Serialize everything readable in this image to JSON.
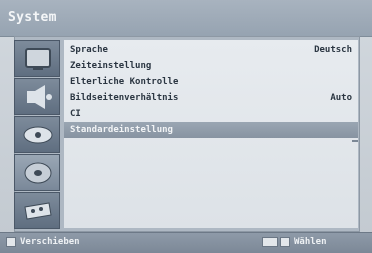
{
  "window": {
    "title": "System"
  },
  "sidebar": {
    "items": [
      {
        "icon": "tv-screen-icon",
        "active": false
      },
      {
        "icon": "speaker-icon",
        "active": false
      },
      {
        "icon": "satellite-dish-icon",
        "active": false
      },
      {
        "icon": "gear-disc-icon",
        "active": true
      },
      {
        "icon": "remote-control-icon",
        "active": false
      }
    ]
  },
  "menu": {
    "rows": [
      {
        "label": "Sprache",
        "value": "Deutsch"
      },
      {
        "label": "Zeiteinstellung",
        "value": ""
      },
      {
        "label": "Elterliche Kontrolle",
        "value": ""
      },
      {
        "label": "Bildseitenverhältnis",
        "value": "Auto"
      },
      {
        "label": "CI",
        "value": ""
      },
      {
        "label": "Standardeinstellung",
        "value": ""
      }
    ],
    "selected_index": 5
  },
  "footer": {
    "left_hint": "Verschieben",
    "right_hint": "Wählen"
  },
  "colors": {
    "titlebar": "#96a3b1",
    "selected_row": "#8793a1",
    "content_bg": "#e7ebef"
  }
}
